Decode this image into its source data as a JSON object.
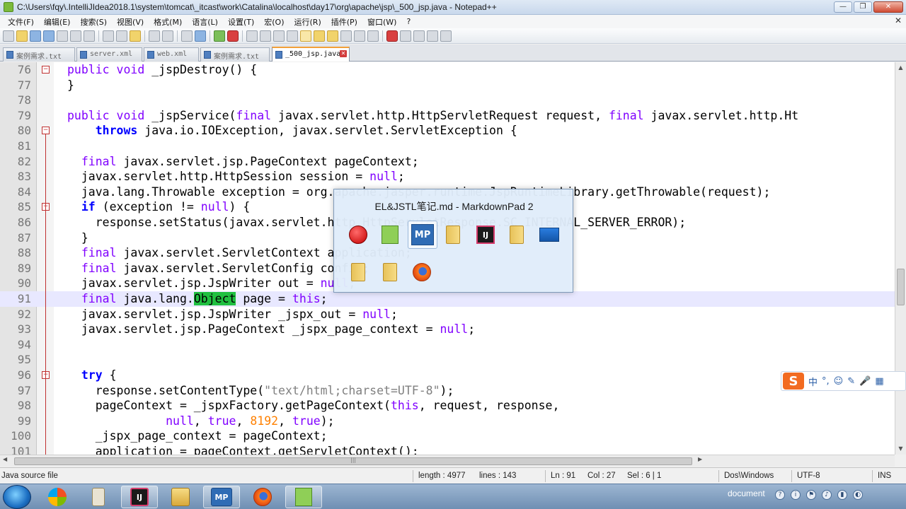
{
  "window": {
    "title": "C:\\Users\\fqy\\.IntelliJIdea2018.1\\system\\tomcat\\_itcast\\work\\Catalina\\localhost\\day17\\org\\apache\\jsp\\_500_jsp.java - Notepad++",
    "controls": [
      "—",
      "❐",
      "✕"
    ]
  },
  "menu": {
    "items": [
      "文件(F)",
      "编辑(E)",
      "搜索(S)",
      "视图(V)",
      "格式(M)",
      "语言(L)",
      "设置(T)",
      "宏(O)",
      "运行(R)",
      "插件(P)",
      "窗口(W)",
      "?"
    ],
    "close": "✕"
  },
  "tabs": [
    {
      "label": "案例需求.txt",
      "close": ""
    },
    {
      "label": "server.xml",
      "close": ""
    },
    {
      "label": "web.xml",
      "close": ""
    },
    {
      "label": "案例需求.txt",
      "close": ""
    },
    {
      "label": "_500_jsp.java",
      "close": "✕"
    }
  ],
  "editor": {
    "current_line": 91,
    "lines": [
      {
        "n": "76",
        "t": "public void _jspDestroy() {"
      },
      {
        "n": "77",
        "t": "}"
      },
      {
        "n": "78",
        "t": ""
      },
      {
        "n": "79",
        "t": "public void _jspService(final javax.servlet.http.HttpServletRequest request, final javax.servlet.http.Ht"
      },
      {
        "n": "80",
        "t": "    throws java.io.IOException, javax.servlet.ServletException {"
      },
      {
        "n": "81",
        "t": ""
      },
      {
        "n": "82",
        "t": "  final javax.servlet.jsp.PageContext pageContext;"
      },
      {
        "n": "83",
        "t": "  javax.servlet.http.HttpSession session = null;"
      },
      {
        "n": "84",
        "t": "  java.lang.Throwable exception = org.apache.jasper.runtime.JspRuntimeLibrary.getThrowable(request);"
      },
      {
        "n": "85",
        "t": "  if (exception != null) {"
      },
      {
        "n": "86",
        "t": "    response.setStatus(javax.servlet.http.HttpServletResponse.SC_INTERNAL_SERVER_ERROR);"
      },
      {
        "n": "87",
        "t": "  }"
      },
      {
        "n": "88",
        "t": "  final javax.servlet.ServletContext application;"
      },
      {
        "n": "89",
        "t": "  final javax.servlet.ServletConfig config;"
      },
      {
        "n": "90",
        "t": "  javax.servlet.jsp.JspWriter out = null;"
      },
      {
        "n": "91",
        "t": "  final java.lang.Object page = this;"
      },
      {
        "n": "92",
        "t": "  javax.servlet.jsp.JspWriter _jspx_out = null;"
      },
      {
        "n": "93",
        "t": "  javax.servlet.jsp.PageContext _jspx_page_context = null;"
      },
      {
        "n": "94",
        "t": ""
      },
      {
        "n": "95",
        "t": ""
      },
      {
        "n": "96",
        "t": "  try {"
      },
      {
        "n": "97",
        "t": "    response.setContentType(\"text/html;charset=UTF-8\");"
      },
      {
        "n": "98",
        "t": "    pageContext = _jspxFactory.getPageContext(this, request, response,"
      },
      {
        "n": "99",
        "t": "              null, true, 8192, true);"
      },
      {
        "n": "100",
        "t": "    _jspx_page_context = pageContext;"
      },
      {
        "n": "101",
        "t": "    application = pageContext.getServletContext();"
      }
    ]
  },
  "statusbar": {
    "file_type": "Java source file",
    "length": "length : 4977",
    "lines": "lines : 143",
    "ln": "Ln : 91",
    "col": "Col : 27",
    "sel": "Sel : 6 | 1",
    "eol": "Dos\\Windows",
    "encoding": "UTF-8",
    "mode": "INS"
  },
  "switcher": {
    "title": "EL&JSTL笔记.md - MarkdownPad 2",
    "icons": [
      "record-icon",
      "notepadpp-icon",
      "markdownpad-icon",
      "folder-icon",
      "intellij-icon",
      "folder-icon",
      "desktop-icon",
      "folder-icon",
      "folder-icon",
      "firefox-icon"
    ]
  },
  "ime": {
    "logo": "S",
    "items": [
      "中",
      "°,",
      "☺",
      "✎",
      "🎤",
      "▦"
    ]
  },
  "taskbar": {
    "tray_text": "document",
    "apps": [
      "start-orb",
      "windows-flag",
      "notepad-pencil",
      "intellij",
      "explorer",
      "markdownpad",
      "firefox",
      "notepadpp"
    ],
    "mp_label": "MP",
    "ij_label": "IJ"
  }
}
